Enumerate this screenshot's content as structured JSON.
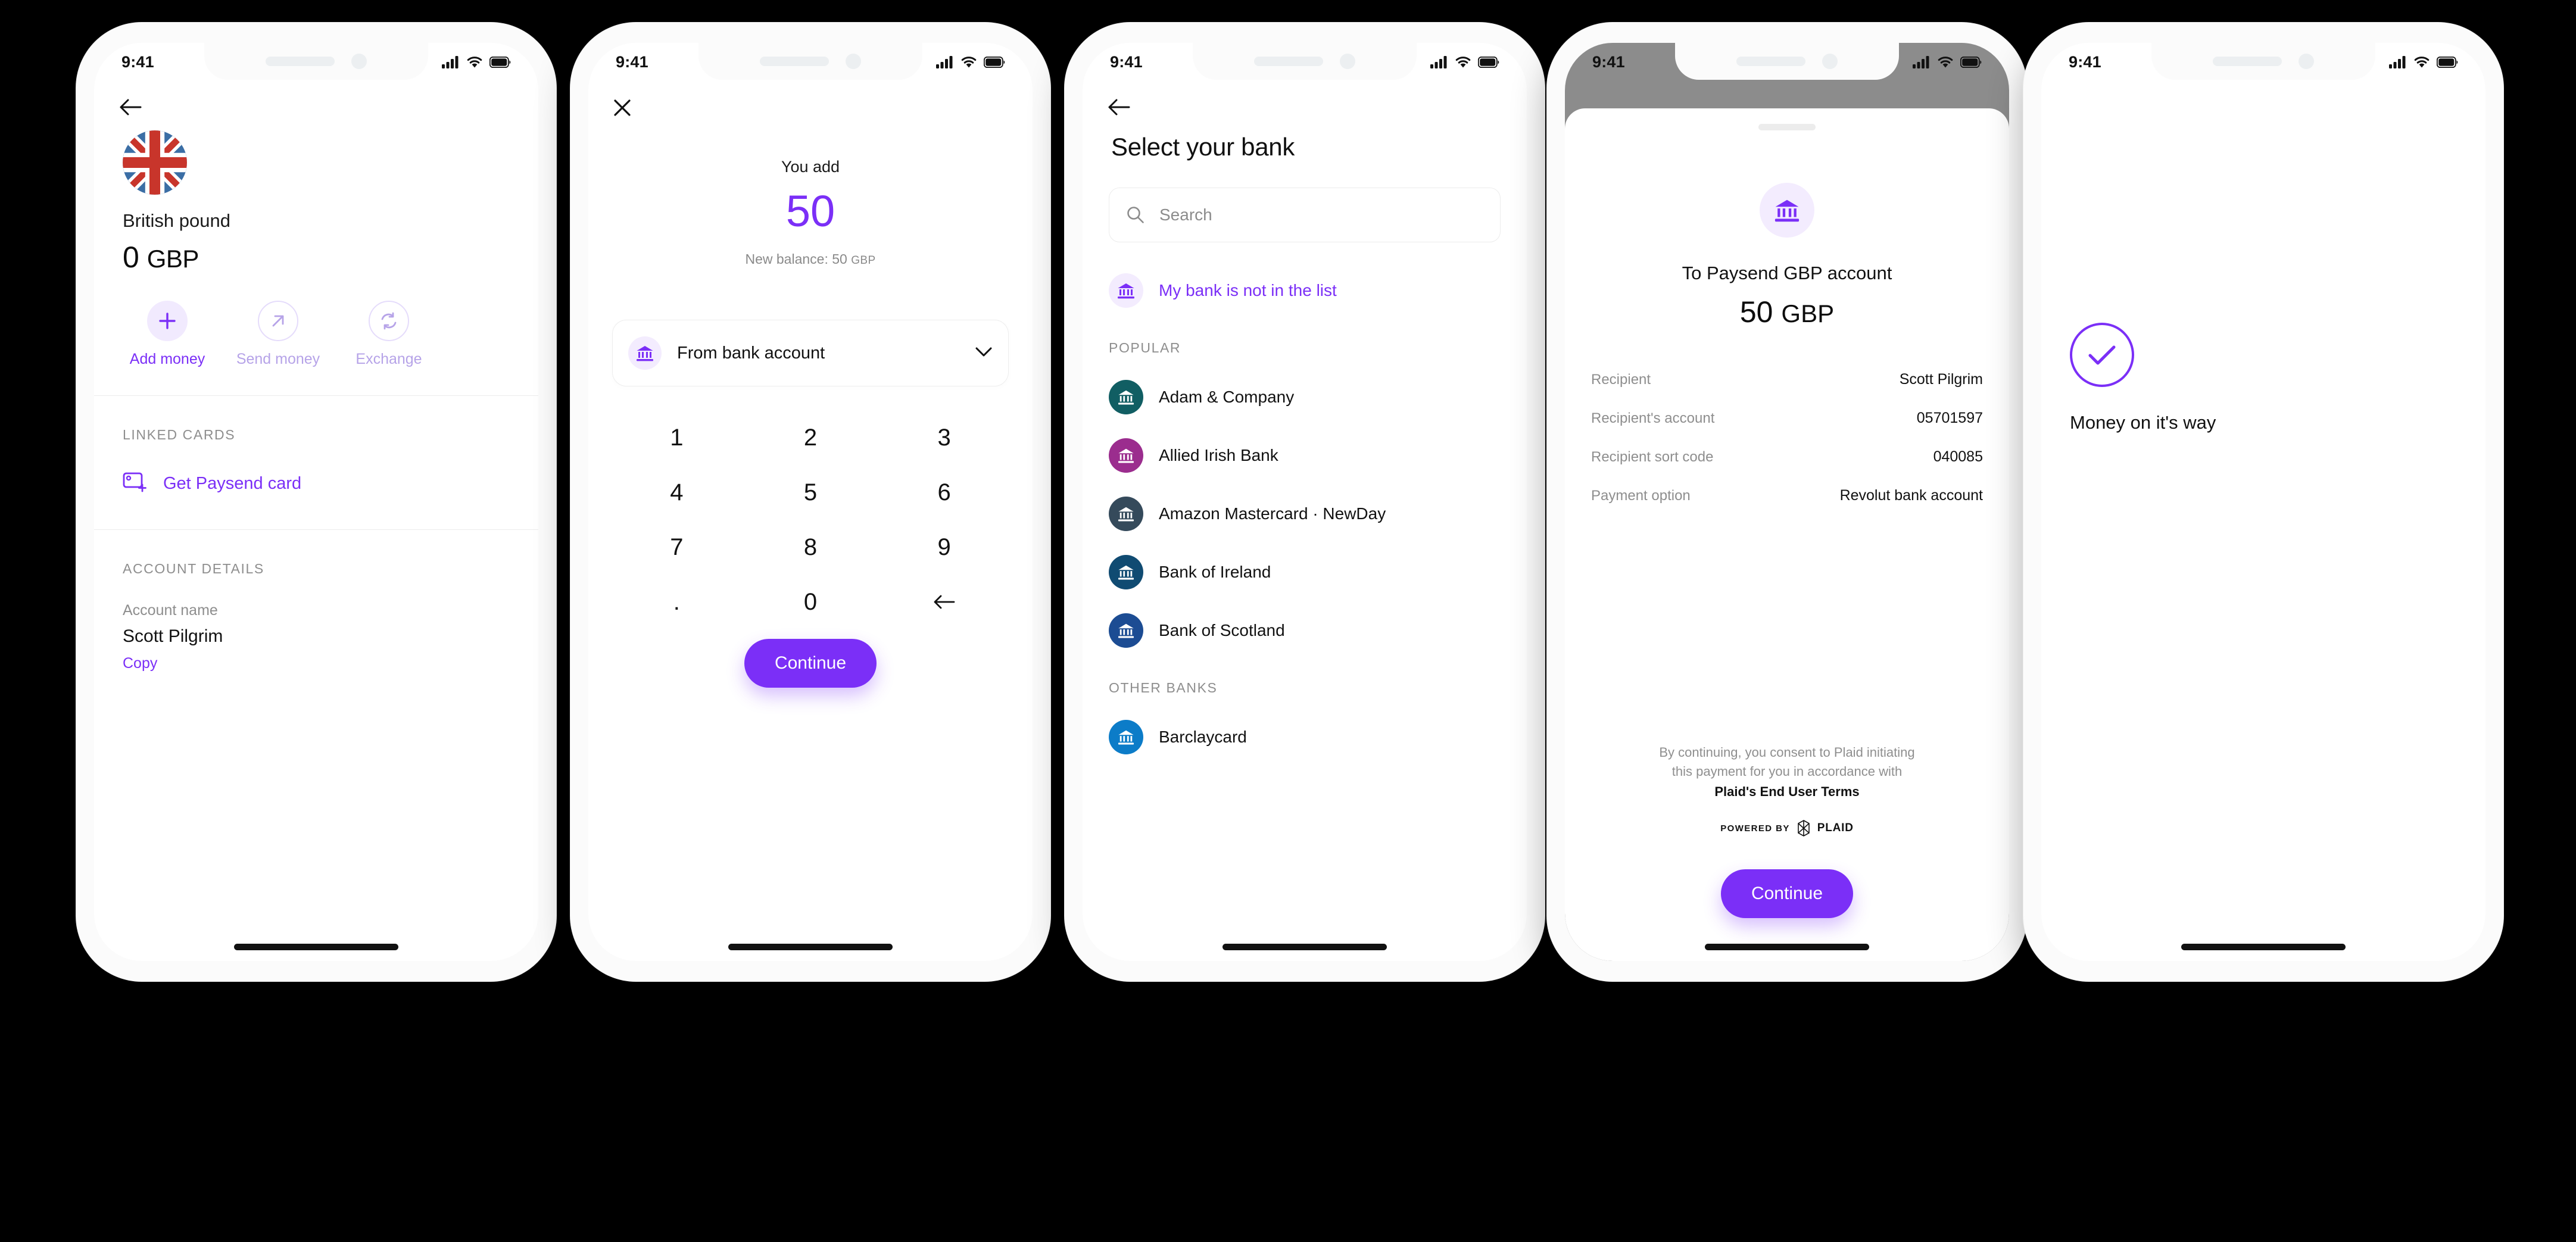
{
  "theme": {
    "accent": "#7B2FF7",
    "accent_soft": "#F3ECFE",
    "accent_muted": "#B6A3E8",
    "text": "#111111",
    "muted": "#8E8E8E"
  },
  "status_bar": {
    "time": "9:41",
    "cellular_icon": "cellular-signal-icon",
    "wifi_icon": "wifi-icon",
    "battery_icon": "battery-icon"
  },
  "screen1": {
    "back_icon": "back-arrow-icon",
    "flag_icon": "uk-flag-icon",
    "currency_name": "British pound",
    "balance_amount": "0",
    "balance_currency": "GBP",
    "actions": [
      {
        "label": "Add money",
        "icon": "plus-icon",
        "state": "enabled"
      },
      {
        "label": "Send money",
        "icon": "arrow-up-right-icon",
        "state": "disabled"
      },
      {
        "label": "Exchange",
        "icon": "refresh-exchange-icon",
        "state": "disabled"
      }
    ],
    "linked_cards_title": "LINKED CARDS",
    "get_card_label": "Get Paysend card",
    "get_card_icon": "card-add-icon",
    "account_details_title": "ACCOUNT DETAILS",
    "account_name_label": "Account name",
    "account_name_value": "Scott Pilgrim",
    "copy_label": "Copy"
  },
  "screen2": {
    "close_icon": "close-x-icon",
    "you_add_label": "You add",
    "amount": "50",
    "new_balance_prefix": "New balance: 50",
    "new_balance_currency": "GBP",
    "source_icon": "bank-icon",
    "source_label": "From bank account",
    "chevron_icon": "chevron-down-icon",
    "keys": [
      "1",
      "2",
      "3",
      "4",
      "5",
      "6",
      "7",
      "8",
      "9",
      ".",
      "0",
      "backspace-icon"
    ],
    "continue_label": "Continue"
  },
  "screen3": {
    "back_icon": "back-arrow-icon",
    "title": "Select your bank",
    "search_placeholder": "Search",
    "search_icon": "search-icon",
    "not_in_list_label": "My bank is not in the list",
    "not_in_list_icon": "bank-icon",
    "popular_title": "POPULAR",
    "other_title": "OTHER BANKS",
    "popular_banks": [
      {
        "name": "Adam & Company",
        "color": "#115E63"
      },
      {
        "name": "Allied Irish Bank",
        "color": "#9B2D8E"
      },
      {
        "name": "Amazon Mastercard · NewDay",
        "color": "#354A5B"
      },
      {
        "name": "Bank of Ireland",
        "color": "#104B72"
      },
      {
        "name": "Bank of Scotland",
        "color": "#1C4C93"
      }
    ],
    "other_banks": [
      {
        "name": "Barclaycard",
        "color": "#0C7CC8"
      }
    ]
  },
  "screen4": {
    "bank_icon": "bank-icon",
    "to_label": "To Paysend GBP account",
    "amount": "50",
    "amount_currency": "GBP",
    "rows": [
      {
        "key": "Recipient",
        "value": "Scott Pilgrim"
      },
      {
        "key": "Recipient's account",
        "value": "05701597"
      },
      {
        "key": "Recipient sort code",
        "value": "040085"
      },
      {
        "key": "Payment option",
        "value": "Revolut bank account"
      }
    ],
    "consent_line1": "By continuing, you consent to Plaid initiating",
    "consent_line2": "this payment for you in accordance with",
    "consent_terms": "Plaid's End User Terms",
    "powered_by": "POWERED BY",
    "plaid_name": "PLAID",
    "plaid_logo_icon": "plaid-logo-icon",
    "continue_label": "Continue"
  },
  "screen5": {
    "check_icon": "check-circle-icon",
    "message": "Money on it's way"
  }
}
